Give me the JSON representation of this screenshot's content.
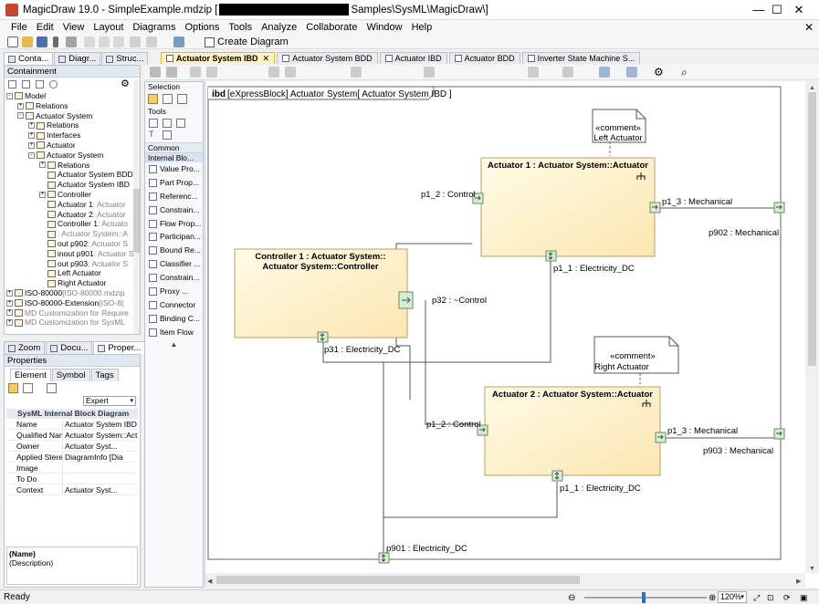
{
  "window": {
    "title_prefix": "MagicDraw 19.0 - SimpleExample.mdzip [",
    "title_suffix": "Samples\\SysML\\MagicDraw\\]",
    "minimize": "—",
    "maximize": "☐",
    "close": "✕"
  },
  "menu": [
    "File",
    "Edit",
    "View",
    "Layout",
    "Diagrams",
    "Options",
    "Tools",
    "Analyze",
    "Collaborate",
    "Window",
    "Help"
  ],
  "menu_close": "✕",
  "toolbar": {
    "create_diagram": "Create Diagram"
  },
  "left_tabs": [
    "Conta...",
    "Diagr...",
    "Struc..."
  ],
  "containment": {
    "header": "Containment",
    "tree": [
      {
        "label": "Model",
        "depth": 0,
        "exp": "-"
      },
      {
        "label": "Relations",
        "depth": 1,
        "exp": "+"
      },
      {
        "label": "Actuator System",
        "depth": 1,
        "exp": "-"
      },
      {
        "label": "Relations",
        "depth": 2,
        "exp": "+"
      },
      {
        "label": "Interfaces",
        "depth": 2,
        "exp": "+"
      },
      {
        "label": "Actuator",
        "depth": 2,
        "exp": "+"
      },
      {
        "label": "Actuator System",
        "depth": 2,
        "exp": "-"
      },
      {
        "label": "Relations",
        "depth": 3,
        "exp": "+"
      },
      {
        "label": "Actuator System BDD",
        "depth": 3,
        "exp": ""
      },
      {
        "label": "Actuator System IBD",
        "depth": 3,
        "exp": ""
      },
      {
        "label": "Controller",
        "depth": 3,
        "exp": "+"
      },
      {
        "label": "Actuator 1",
        "dim": " : Actuator",
        "depth": 3,
        "exp": ""
      },
      {
        "label": "Actuator 2",
        "dim": " : Actuator",
        "depth": 3,
        "exp": ""
      },
      {
        "label": "Controller 1",
        "dim": " : Actuato",
        "depth": 3,
        "exp": ""
      },
      {
        "label": "",
        "dim": ": Actuator System::A",
        "depth": 3,
        "exp": ""
      },
      {
        "label": "out p902",
        "dim": " : Actuator S",
        "depth": 3,
        "exp": ""
      },
      {
        "label": "inout p901",
        "dim": " : Actuator S",
        "depth": 3,
        "exp": ""
      },
      {
        "label": "out p903",
        "dim": " : Actuator S",
        "depth": 3,
        "exp": ""
      },
      {
        "label": "Left Actuator",
        "depth": 3,
        "exp": ""
      },
      {
        "label": "Right Actuator",
        "depth": 3,
        "exp": ""
      },
      {
        "label": "ISO-80000",
        "dim": " [ISO-80000.mdzip",
        "depth": 0,
        "exp": "+"
      },
      {
        "label": "ISO-80000-Extension",
        "dim": " [ISO-8(",
        "depth": 0,
        "exp": "+"
      },
      {
        "label": "MD Customization for Require",
        "depth": 0,
        "exp": "+",
        "alldim": true
      },
      {
        "label": "MD Customization for SysML",
        "depth": 0,
        "exp": "+",
        "alldim": true
      }
    ]
  },
  "bottom_tabs": [
    "Zoom",
    "Docu...",
    "Proper..."
  ],
  "properties": {
    "header": "Properties",
    "tabs": [
      "Element",
      "Symbol",
      "Tags"
    ],
    "mode": "Expert",
    "section": "SysML Internal Block Diagram",
    "rows": [
      {
        "name": "Name",
        "value": "Actuator System IBD"
      },
      {
        "name": "Qualified Name",
        "value": "Actuator System::Act"
      },
      {
        "name": "Owner",
        "value": "Actuator Syst..."
      },
      {
        "name": "Applied Stereo...",
        "value": "DiagramInfo [Dia"
      },
      {
        "name": "Image",
        "value": ""
      },
      {
        "name": "To Do",
        "value": ""
      },
      {
        "name": "Context",
        "value": "Actuator Syst..."
      }
    ],
    "desc_title": "(Name)",
    "desc_text": "(Description)"
  },
  "palette": {
    "selection": "Selection",
    "tools": "Tools",
    "common": "Common",
    "internal_block": "Internal Blo...",
    "items": [
      "Value Pro...",
      "Part Prop...",
      "Referenc...",
      "Constrain...",
      "Flow Prop...",
      "Participan...",
      "Bound Re...",
      "Classifier ...",
      "Constrain...",
      "Proxy ...",
      "Connector",
      "Binding C...",
      "Item Flow"
    ]
  },
  "diagram_tabs": [
    "Actuator System IBD",
    "Actuator System BDD",
    "Actuator IBD",
    "Actuator BDD",
    "Inverter State Machine S..."
  ],
  "diagram_tab_close": "✕",
  "diagram": {
    "frame_kind": "ibd",
    "frame_title": "[eXpressBlock] Actuator System[ Actuator System IBD ]",
    "actuator1": "Actuator 1 : Actuator System::Actuator",
    "actuator2": "Actuator 2 : Actuator System::Actuator",
    "controller_l1": "Controller 1 : Actuator System::",
    "controller_l2": "Actuator System::Controller",
    "comment_left_st": "«comment»",
    "comment_left": "Left Actuator",
    "comment_right_st": "«comment»",
    "comment_right": "Right Actuator",
    "a1_p12": "p1_2 : Control",
    "a1_p13": "p1_3 : Mechanical",
    "a1_p11": "p1_1 : Electricity_DC",
    "a2_p12": "p1_2 : Control",
    "a2_p13": "p1_3 : Mechanical",
    "a2_p11": "p1_1 : Electricity_DC",
    "p902": "p902 : Mechanical",
    "p903": "p903 : Mechanical",
    "p901": "p901 : Electricity_DC",
    "p32": "p32 : ~Control",
    "p31": "p31 : Electricity_DC"
  },
  "status": {
    "text": "Ready",
    "zoom": "120%"
  },
  "colors": {
    "block_fill_top": "#fffbe6",
    "block_fill_bottom": "#fbe6b0",
    "port_fill": "#d8ecd8",
    "tab_active": "#fff3c4"
  }
}
